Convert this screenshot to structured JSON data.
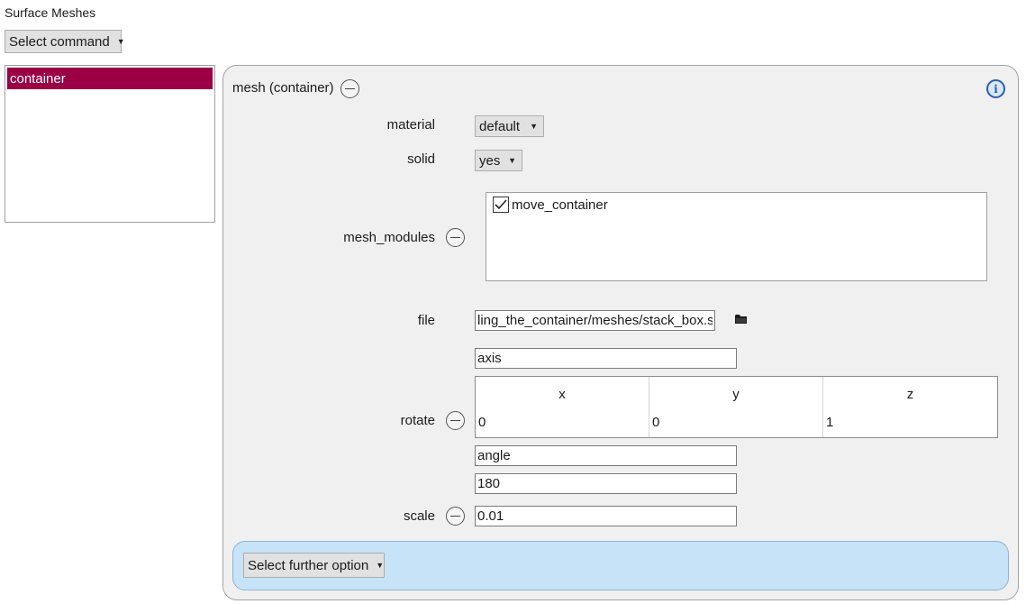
{
  "header": {
    "title": "Surface Meshes",
    "select_command": "Select command"
  },
  "mesh_list": {
    "items": [
      "container"
    ]
  },
  "panel": {
    "title": "mesh (container)",
    "material": {
      "label": "material",
      "value": "default"
    },
    "solid": {
      "label": "solid",
      "value": "yes"
    },
    "mesh_modules": {
      "label": "mesh_modules",
      "items": [
        {
          "name": "move_container",
          "checked": true
        }
      ]
    },
    "file": {
      "label": "file",
      "value": "ling_the_container/meshes/stack_box.stl"
    },
    "rotate": {
      "label": "rotate",
      "axis_label": "axis",
      "columns": [
        "x",
        "y",
        "z"
      ],
      "values": [
        "0",
        "0",
        "1"
      ],
      "angle_label": "angle",
      "angle_value": "180"
    },
    "scale": {
      "label": "scale",
      "value": "0.01"
    },
    "further_option": "Select further option"
  },
  "colors": {
    "selection": "#9b0045",
    "panel_bg": "#f0f0f0",
    "options_bar": "#c6e3f7"
  },
  "icons": {
    "collapse": "minus-circle-icon",
    "info": "info-icon",
    "folder": "folder-icon",
    "dropdown": "triangle-down-icon"
  }
}
